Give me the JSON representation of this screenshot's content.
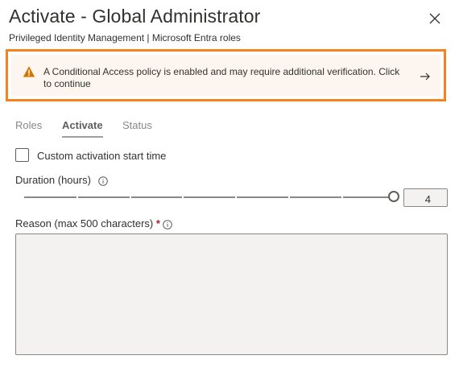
{
  "panel": {
    "title": "Activate - Global Administrator",
    "subtitle": "Privileged Identity Management | Microsoft Entra roles"
  },
  "banner": {
    "text": "A Conditional Access policy is enabled and may require additional verification. Click to continue",
    "icon": "warning-icon",
    "action_icon": "arrow-right-icon",
    "accent_color": "#f7811d"
  },
  "tabs": [
    {
      "label": "Roles",
      "active": false
    },
    {
      "label": "Activate",
      "active": true
    },
    {
      "label": "Status",
      "active": false
    }
  ],
  "form": {
    "custom_start_label": "Custom activation start time",
    "custom_start_checked": false,
    "duration_label": "Duration (hours)",
    "duration_value": "4",
    "duration_slider_fraction": 1.0,
    "reason_label": "Reason (max 500 characters)",
    "required_marker": "*",
    "reason_value": ""
  },
  "colors": {
    "banner_border": "#f7811d",
    "warning_icon": "#d47500",
    "required": "#a4262c"
  }
}
